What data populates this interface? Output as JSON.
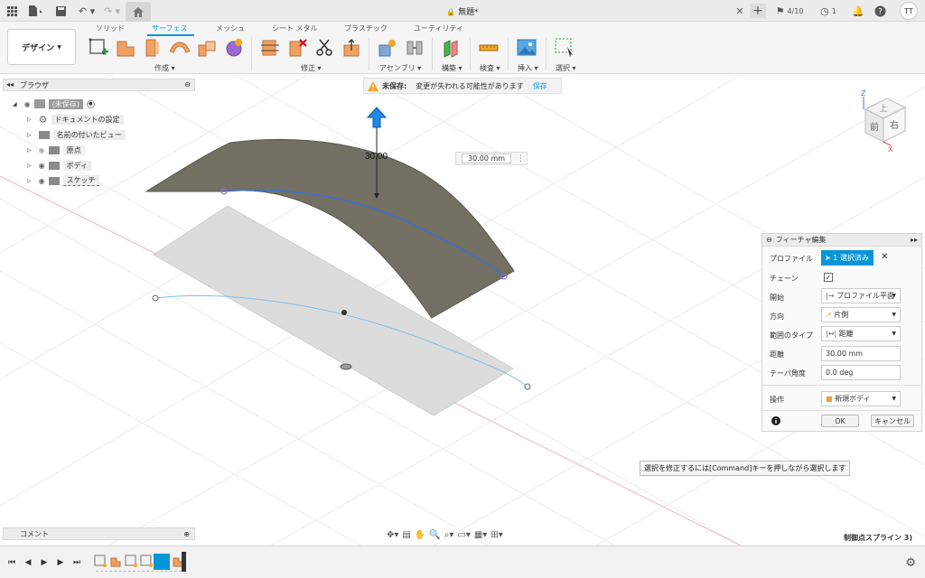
{
  "topbar": {
    "title": "無題*",
    "job_count": "4/10",
    "clock_count": "1",
    "user_initials": "TT"
  },
  "toolbar": {
    "design_label": "デザイン",
    "tabs": [
      "ソリッド",
      "サーフェス",
      "メッシュ",
      "シート メタル",
      "プラスチック",
      "ユーティリティ"
    ],
    "active_tab": "サーフェス",
    "groups": [
      "作成",
      "修正",
      "アセンブリ",
      "構築",
      "検査",
      "挿入",
      "選択"
    ]
  },
  "browser": {
    "title": "ブラウザ",
    "root": "(未保存)",
    "items": [
      "ドキュメントの設定",
      "名前の付いたビュー",
      "原点",
      "ボディ",
      "スケッチ"
    ]
  },
  "warning": {
    "label": "未保存:",
    "message": "変更が失われる可能性があります",
    "save": "保存"
  },
  "viewport": {
    "dimension_label": "30.00",
    "distance_input": "30.00 mm",
    "viewcube": {
      "top": "上",
      "front": "前",
      "right": "右",
      "axis_x": "X",
      "axis_z": "Z"
    }
  },
  "panel": {
    "title": "フィーチャ編集",
    "rows": {
      "profile_label": "プロファイル",
      "profile_value": "1 選択済み",
      "chain_label": "チェーン",
      "start_label": "開始",
      "start_value": "プロファイル平面",
      "direction_label": "方向",
      "direction_value": "片側",
      "extent_label": "範囲のタイプ",
      "extent_value": "距離",
      "distance_label": "距離",
      "distance_value": "30.00 mm",
      "taper_label": "テーパ角度",
      "taper_value": "0.0 deg",
      "operation_label": "操作",
      "operation_value": "新規ボディ"
    },
    "ok": "OK",
    "cancel": "キャンセル"
  },
  "tooltip": "選択を修正するには[Command]キーを押しながら選択します",
  "comment_label": "コメント",
  "status_text": "制御点スプライン 3)",
  "colors": {
    "accent": "#0696d7",
    "surface": "#736f63"
  }
}
